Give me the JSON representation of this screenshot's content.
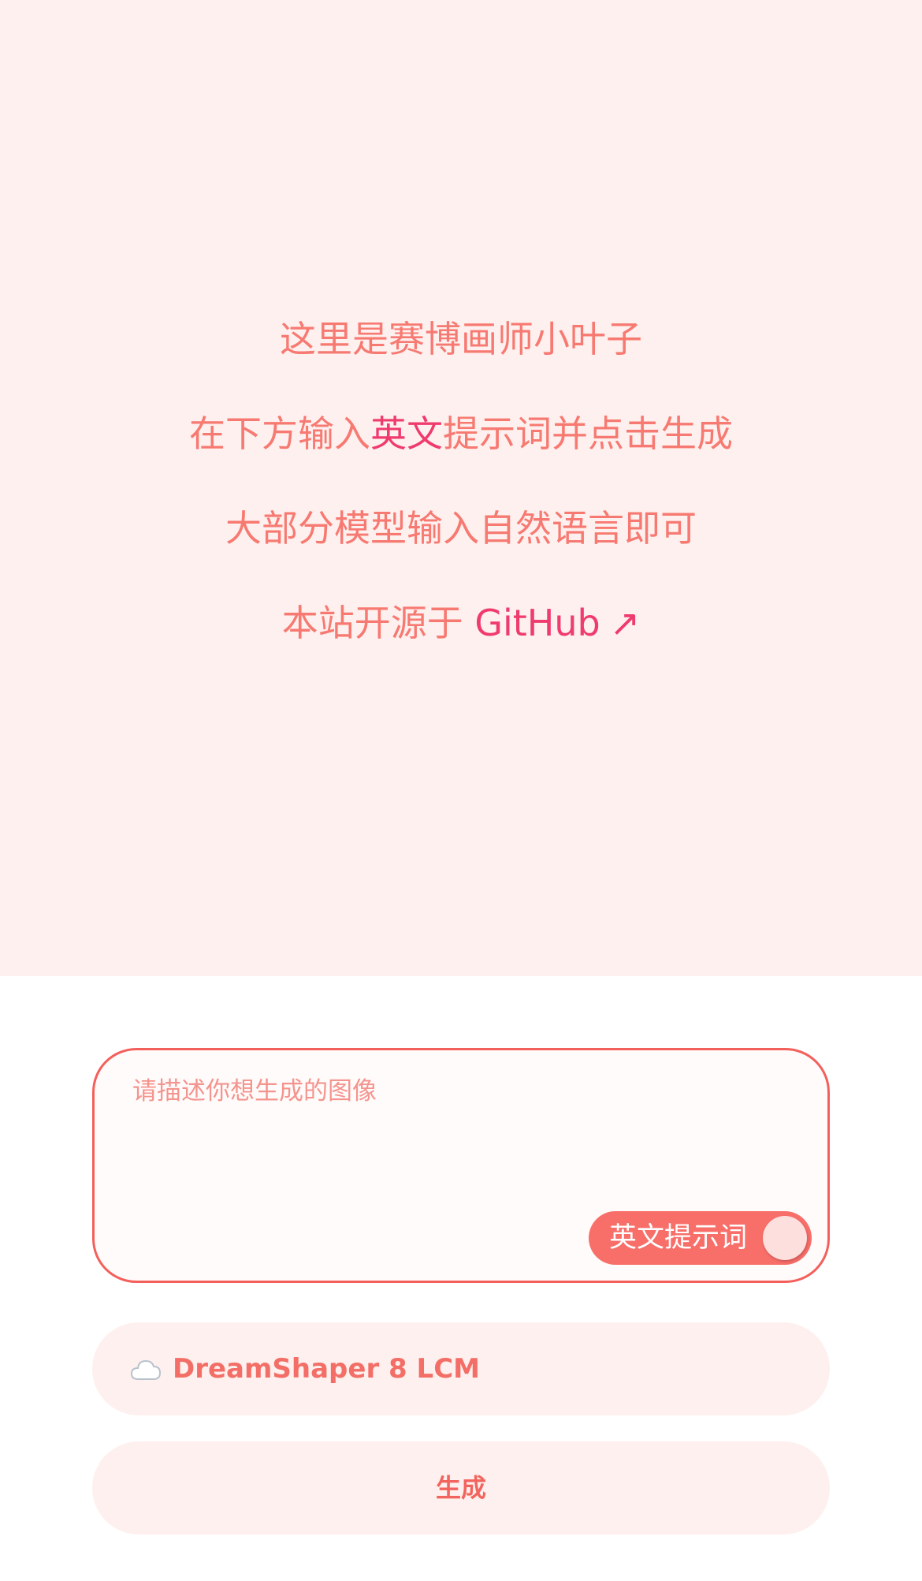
{
  "intro": {
    "line1": "这里是赛博画师小叶子",
    "line2_before": "在下方输入",
    "line2_highlight": "英文",
    "line2_after": "提示词并点击生成",
    "line3": "大部分模型输入自然语言即可",
    "line4_text": "本站开源于 ",
    "line4_link": "GitHub",
    "line4_arrow": "↗"
  },
  "prompt": {
    "placeholder": "请描述你想生成的图像",
    "value": "",
    "toggle_label": "英文提示词"
  },
  "model": {
    "icon": "cloud-icon",
    "label": "DreamShaper 8 LCM"
  },
  "generate": {
    "label": "生成"
  },
  "colors": {
    "hero_bg": "#fef0ee",
    "text": "#f77a72",
    "accent": "#ef3b6e",
    "border": "#f3605c",
    "toggle": "#f86f6a"
  }
}
